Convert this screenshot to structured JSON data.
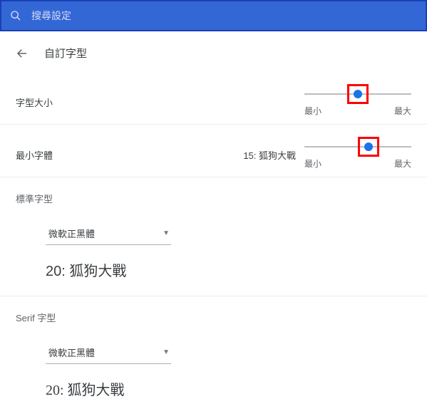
{
  "search": {
    "placeholder": "搜尋設定"
  },
  "header": {
    "title": "自訂字型"
  },
  "fontSize": {
    "label": "字型大小",
    "min_label": "最小",
    "max_label": "最大",
    "thumb_percent": 50
  },
  "minFont": {
    "label": "最小字體",
    "value": "15: 狐狗大戰",
    "min_label": "最小",
    "max_label": "最大",
    "thumb_percent": 60
  },
  "standard": {
    "section": "標準字型",
    "font": "微軟正黑體",
    "sample": "20: 狐狗大戰"
  },
  "serif": {
    "section": "Serif 字型",
    "font": "微軟正黑體",
    "sample": "20: 狐狗大戰"
  }
}
